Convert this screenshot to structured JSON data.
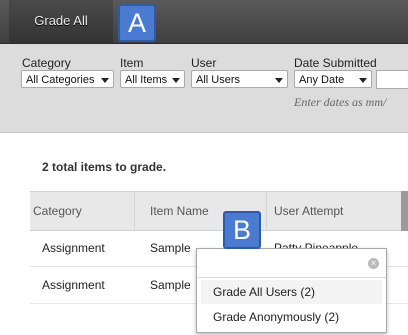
{
  "tabs": {
    "active_label": "Grade All"
  },
  "callouts": {
    "a": "A",
    "b": "B"
  },
  "filters": {
    "category": {
      "label": "Category",
      "value": "All Categories"
    },
    "item": {
      "label": "Item",
      "value": "All Items"
    },
    "user": {
      "label": "User",
      "value": "All Users"
    },
    "date": {
      "label": "Date Submitted",
      "value": "Any Date",
      "hint": "Enter dates as mm/"
    }
  },
  "summary": {
    "count_text": "2 total items to grade."
  },
  "table": {
    "headers": [
      "Category",
      "Item Name",
      "User Attempt"
    ],
    "rows": [
      {
        "category": "Assignment",
        "item": "Sample",
        "user": "Patty Pineapple"
      },
      {
        "category": "Assignment",
        "item": "Sample",
        "user": ""
      }
    ]
  },
  "menu": {
    "search_value": "",
    "items": [
      "Grade All Users (2)",
      "Grade Anonymously (2)"
    ],
    "close_icon": "×"
  }
}
